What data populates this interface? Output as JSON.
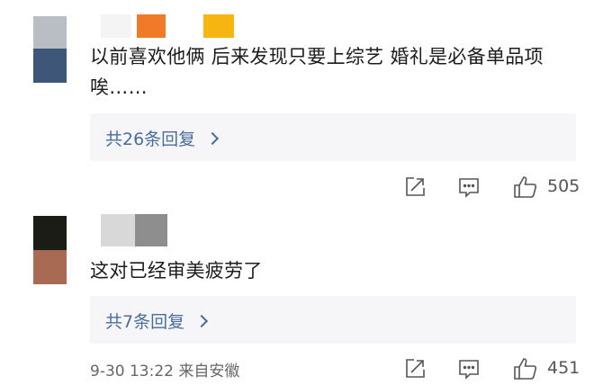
{
  "comments": [
    {
      "text": "以前喜欢他俩 后来发现只要上综艺 婚礼是必备单品项 唉……",
      "reply_label": "共26条回复",
      "like_count": "505",
      "avatar_colors": [
        "#b9bec5",
        "#3e5778"
      ]
    },
    {
      "text": "这对已经审美疲劳了",
      "reply_label": "共7条回复",
      "like_count": "451",
      "timestamp": "9-30 13:22",
      "location": "来自安徽",
      "avatar_colors": [
        "#1c1c16",
        "#a86a52"
      ]
    }
  ],
  "icons": {
    "share": "share-icon",
    "comment": "comment-icon",
    "like": "thumbs-up-icon",
    "chevron": "chevron-right-icon"
  },
  "colors": {
    "link": "#4a6d9a",
    "reply_bg": "#f6f6f8",
    "text": "#1c1c1c",
    "icon": "#555555"
  }
}
